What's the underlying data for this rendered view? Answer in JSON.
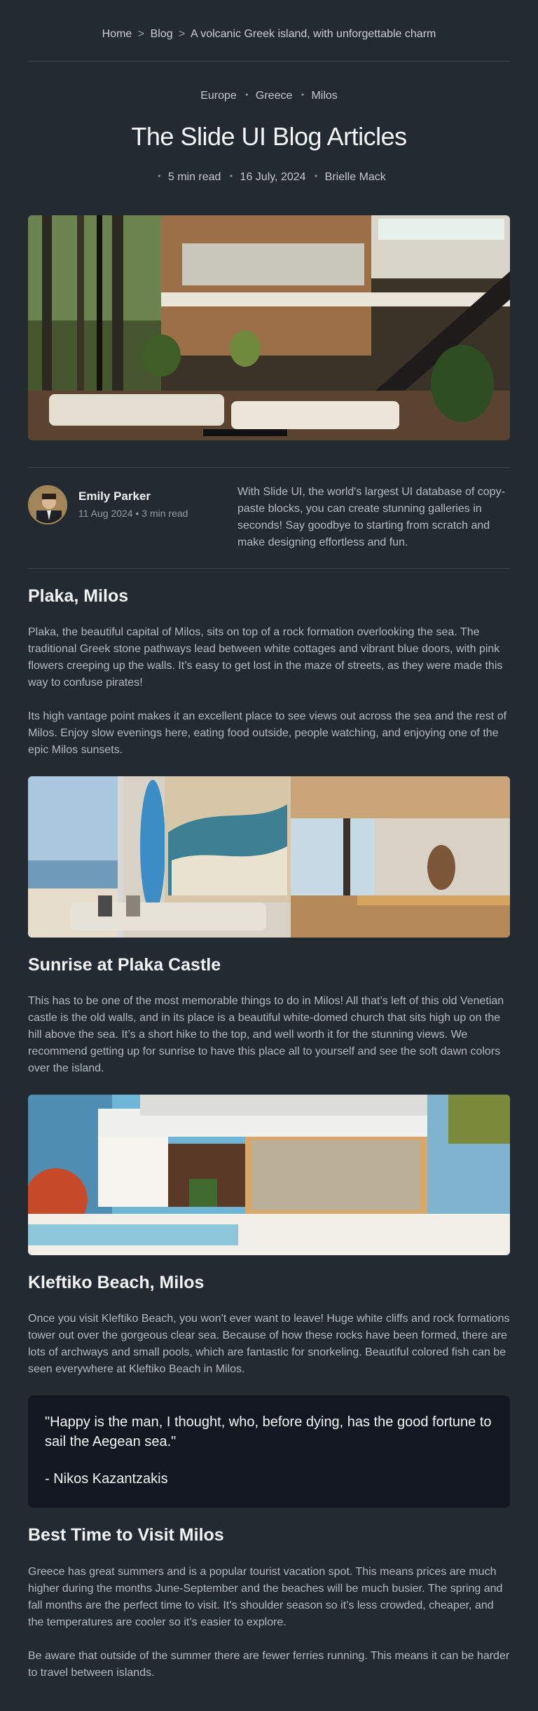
{
  "breadcrumb": {
    "home": "Home",
    "blog": "Blog",
    "current": "A volcanic Greek island, with unforgettable charm",
    "separator": ">"
  },
  "tags": [
    "Europe",
    "Greece",
    "Milos"
  ],
  "article": {
    "title": "The Slide UI Blog Articles",
    "read_time": "5 min read",
    "date": "16 July, 2024",
    "author": "Brielle Mack"
  },
  "author_card": {
    "name": "Emily Parker",
    "date": "11 Aug 2024",
    "read_time": "3 min read",
    "blurb": "With Slide UI, the world's largest UI database of copy-paste blocks, you can create stunning galleries in seconds! Say goodbye to starting from scratch and make designing effortless and fun."
  },
  "sections": {
    "plaka": {
      "heading": "Plaka, Milos",
      "p1": "Plaka, the beautiful capital of Milos, sits on top of a rock formation overlooking the sea. The traditional Greek stone pathways lead between white cottages and vibrant blue doors, with pink flowers creeping up the walls. It’s easy to get lost in the maze of streets, as they were made this way to confuse pirates!",
      "p2": "Its high vantage point makes it an excellent place to see views out across the sea and the rest of Milos. Enjoy slow evenings here, eating food outside, people watching, and enjoying one of the epic Milos sunsets."
    },
    "sunrise": {
      "heading": "Sunrise at Plaka Castle",
      "p1": "This has to be one of the most memorable things to do in Milos! All that’s left of this old Venetian castle is the old walls, and in its place is a beautiful white-domed church that sits high up on the hill above the sea. It’s a short hike to the top, and well worth it for the stunning views. We recommend getting up for sunrise to have this place all to yourself and see the soft dawn colors over the island."
    },
    "kleftiko": {
      "heading": "Kleftiko Beach, Milos",
      "p1": "Once you visit Kleftiko Beach, you won't ever want to leave! Huge white cliffs and rock formations tower out over the gorgeous clear sea. Because of how these rocks have been formed, there are lots of archways and small pools, which are fantastic for snorkeling. Beautiful colored fish can be seen everywhere at Kleftiko Beach in Milos."
    },
    "quote": {
      "text": "\"Happy is the man, I thought, who, before dying, has the good fortune to sail the Aegean sea.\"",
      "author": "- Nikos Kazantzakis"
    },
    "best_time": {
      "heading": "Best Time to Visit Milos",
      "p1": "Greece has great summers and is a popular tourist vacation spot. This means prices are much higher during the months June-September and the beaches will be much busier. The spring and fall months are the perfect time to visit. It’s shoulder season so it’s less crowded, cheaper, and the temperatures are cooler so it’s easier to explore.",
      "p2": "Be aware that outside of the summer there are fewer ferries running. This means it can be harder to travel between islands."
    }
  },
  "colors": {
    "background": "#232a31",
    "quote_bg": "#121722",
    "heading": "#f1f3f5",
    "body_text": "#b3b9c0",
    "divider": "#3d454d"
  }
}
